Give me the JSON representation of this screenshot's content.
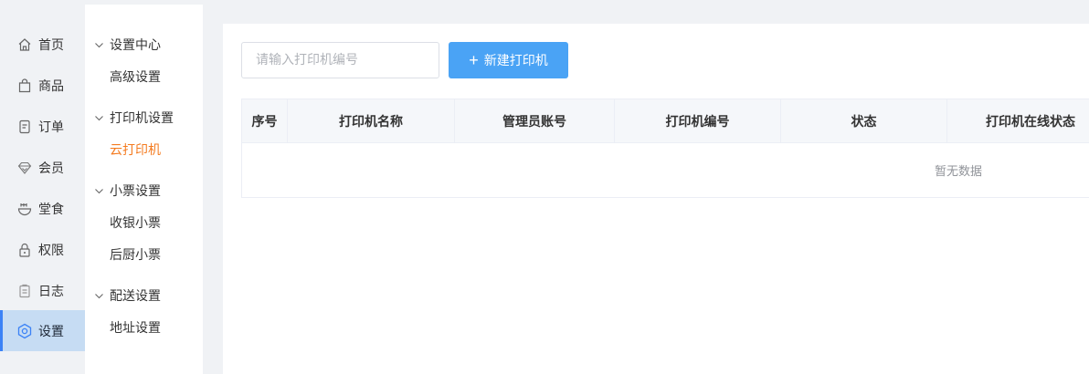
{
  "primary_nav": {
    "items": [
      {
        "label": "首页",
        "icon": "home-icon"
      },
      {
        "label": "商品",
        "icon": "shopping-bag-icon"
      },
      {
        "label": "订单",
        "icon": "order-icon"
      },
      {
        "label": "会员",
        "icon": "diamond-icon"
      },
      {
        "label": "堂食",
        "icon": "bowl-icon"
      },
      {
        "label": "权限",
        "icon": "lock-icon"
      },
      {
        "label": "日志",
        "icon": "clipboard-icon"
      },
      {
        "label": "设置",
        "icon": "settings-icon",
        "active": true
      }
    ]
  },
  "secondary_menu": {
    "groups": [
      {
        "label": "设置中心",
        "items": [
          "高级设置"
        ]
      },
      {
        "label": "打印机设置",
        "items": [
          "云打印机"
        ]
      },
      {
        "label": "小票设置",
        "items": [
          "收银小票",
          "后厨小票"
        ]
      },
      {
        "label": "配送设置",
        "items": [
          "地址设置"
        ]
      }
    ],
    "active_item": "云打印机"
  },
  "toolbar": {
    "search_placeholder": "请输入打印机编号",
    "new_button_label": "新建打印机"
  },
  "table": {
    "columns": [
      "序号",
      "打印机名称",
      "管理员账号",
      "打印机编号",
      "状态",
      "打印机在线状态"
    ],
    "rows": [],
    "empty_text": "暂无数据"
  },
  "colors": {
    "accent": "#4aa3f5",
    "active_menu": "#f47b20",
    "active_nav_bg": "#c6dcf3"
  }
}
